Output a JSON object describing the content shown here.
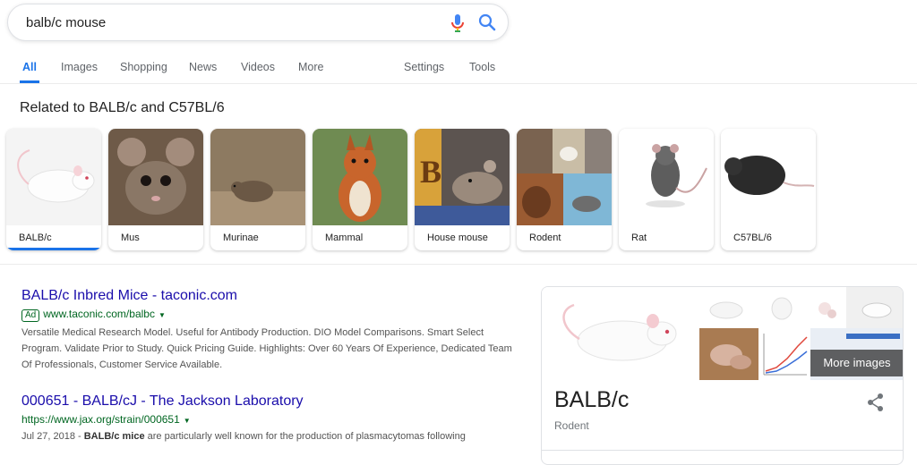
{
  "search": {
    "query": "balb/c mouse"
  },
  "tabs": [
    {
      "label": "All"
    },
    {
      "label": "Images"
    },
    {
      "label": "Shopping"
    },
    {
      "label": "News"
    },
    {
      "label": "Videos"
    },
    {
      "label": "More"
    },
    {
      "label": "Settings"
    },
    {
      "label": "Tools"
    }
  ],
  "related": {
    "title": "Related to BALB/c and C57BL/6",
    "items": [
      {
        "label": "BALB/c"
      },
      {
        "label": "Mus"
      },
      {
        "label": "Murinae"
      },
      {
        "label": "Mammal"
      },
      {
        "label": "House mouse"
      },
      {
        "label": "Rodent"
      },
      {
        "label": "Rat"
      },
      {
        "label": "C57BL/6"
      }
    ]
  },
  "results": [
    {
      "title": "BALB/c Inbred Mice - taconic.com",
      "ad_label": "Ad",
      "url": "www.taconic.com/balbc",
      "snippet": "Versatile Medical Research Model. Useful for Antibody Production. DIO Model Comparisons. Smart Select Program. Validate Prior to Study. Quick Pricing Guide. Highlights: Over 60 Years Of Experience, Dedicated Team Of Professionals, Customer Service Available."
    },
    {
      "title": "000651 - BALB/cJ - The Jackson Laboratory",
      "url": "https://www.jax.org/strain/000651",
      "date": "Jul 27, 2018",
      "date_sep": " - ",
      "snippet_bold": "BALB/c mice",
      "snippet_rest": " are particularly well known for the production of plasmacytomas following"
    }
  ],
  "knowledge_panel": {
    "title": "BALB/c",
    "subtitle": "Rodent",
    "more_images": "More images"
  },
  "colors": {
    "link": "#1a0dab",
    "url": "#006621",
    "accent": "#1a73e8"
  }
}
